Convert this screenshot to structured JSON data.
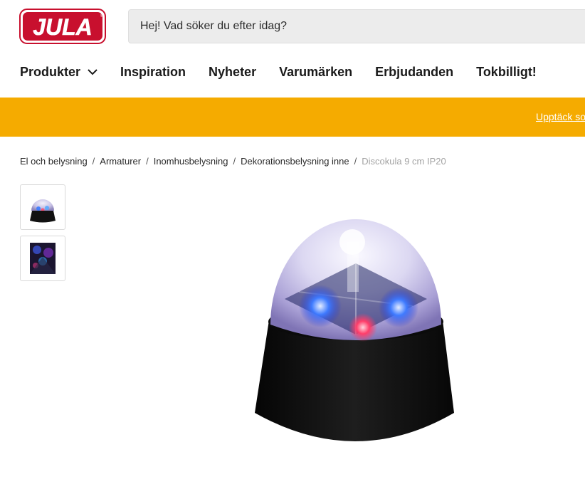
{
  "header": {
    "logo_text": "JULA",
    "search": {
      "placeholder": "Hej! Vad söker du efter idag?"
    }
  },
  "nav": {
    "items": [
      {
        "label": "Produkter",
        "icon": "chevron-down-icon"
      },
      {
        "label": "Inspiration"
      },
      {
        "label": "Nyheter"
      },
      {
        "label": "Varumärken"
      },
      {
        "label": "Erbjudanden"
      },
      {
        "label": "Tokbilligt!"
      }
    ]
  },
  "banner": {
    "link_text": "Upptäck so"
  },
  "breadcrumb": {
    "items": [
      "El och belysning",
      "Armaturer",
      "Inomhusbelysning",
      "Dekorationsbelysning inne"
    ],
    "current": "Discokula 9 cm IP20",
    "separator": "/"
  },
  "product": {
    "thumbnails": [
      "disco-ball-product-thumbnail",
      "disco-ball-in-use-thumbnail"
    ]
  },
  "colors": {
    "brand_red": "#c8102e",
    "banner_yellow": "#f5ab00",
    "search_bg": "#ececec"
  }
}
